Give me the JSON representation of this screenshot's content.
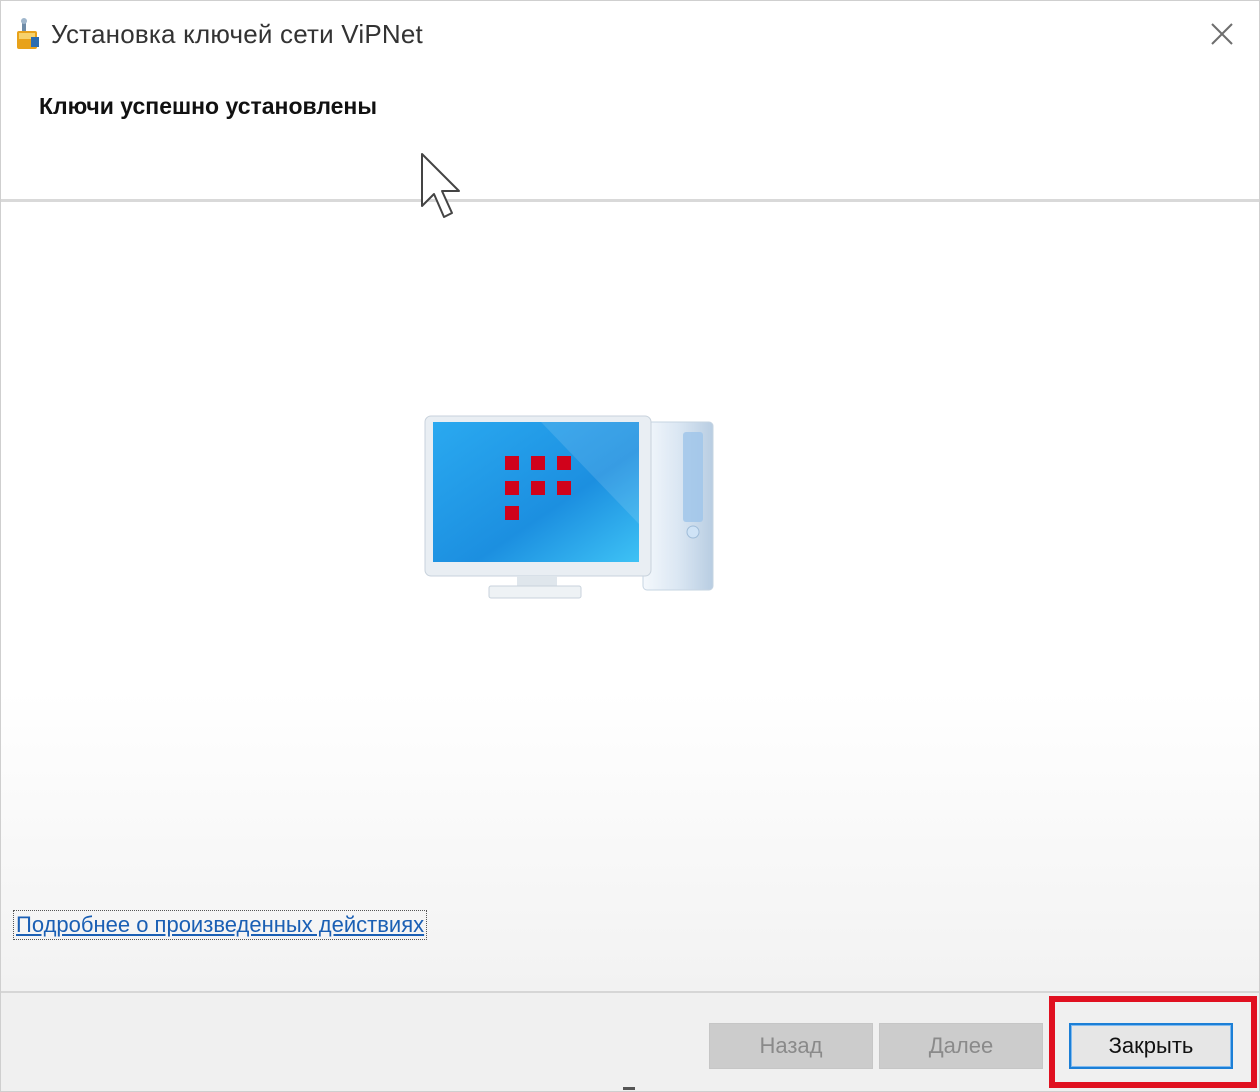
{
  "window": {
    "title": "Установка ключей сети ViPNet"
  },
  "icons": {
    "app": "vipnet-app-icon",
    "close": "close-icon",
    "illustration": "vipnet-computer-icon",
    "cursor": "mouse-pointer-icon"
  },
  "header": {
    "heading": "Ключи успешно установлены"
  },
  "content": {
    "details_link": "Подробнее о произведенных действиях"
  },
  "footer": {
    "back_label": "Назад",
    "next_label": "Далее",
    "close_label": "Закрыть"
  },
  "colors": {
    "highlight": "#e01020",
    "link": "#1a5fb4",
    "focus_border": "#1c7fd6",
    "logo_red": "#d0021b"
  }
}
